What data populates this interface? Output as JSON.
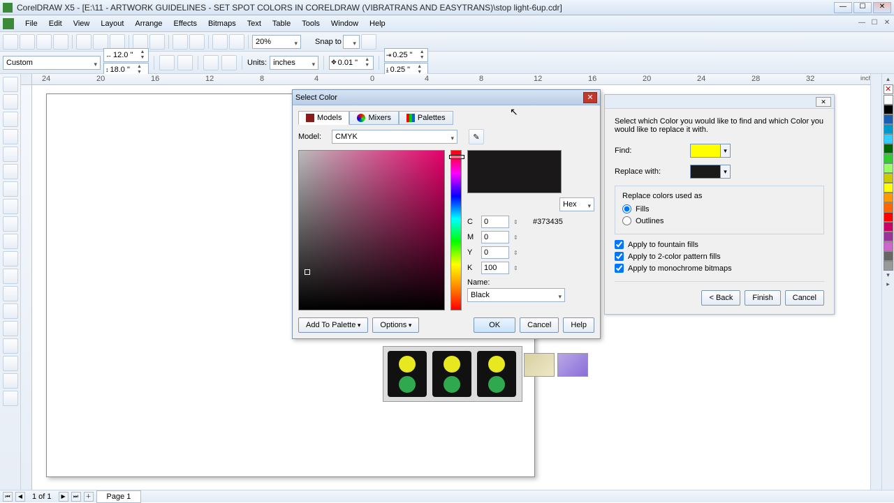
{
  "window": {
    "title": "CorelDRAW X5 - [E:\\11 - ARTWORK GUIDELINES - SET SPOT COLORS IN CORELDRAW (VIBRATRANS AND EASYTRANS)\\stop light-6up.cdr]",
    "min": "—",
    "max": "☐",
    "close": "✕"
  },
  "menu": {
    "items": [
      "File",
      "Edit",
      "View",
      "Layout",
      "Arrange",
      "Effects",
      "Bitmaps",
      "Text",
      "Table",
      "Tools",
      "Window",
      "Help"
    ]
  },
  "std_toolbar": {
    "zoom": "20%",
    "snap_label": "Snap to"
  },
  "prop_bar": {
    "paper": "Custom",
    "w": "12.0 \"",
    "h": "18.0 \"",
    "units_label": "Units:",
    "units": "inches",
    "nudge": "0.01 \"",
    "dup_x": "0.25 \"",
    "dup_y": "0.25 \""
  },
  "ruler": {
    "ticks": [
      "24",
      "20",
      "16",
      "12",
      "8",
      "4",
      "0",
      "4",
      "8",
      "12",
      "16",
      "20",
      "24",
      "28",
      "32"
    ],
    "units": "inches"
  },
  "select_color": {
    "title": "Select Color",
    "tabs": {
      "models": "Models",
      "mixers": "Mixers",
      "palettes": "Palettes"
    },
    "model_label": "Model:",
    "model": "CMYK",
    "format": "Hex",
    "hex": "#373435",
    "c_label": "C",
    "c": "0",
    "m_label": "M",
    "m": "0",
    "y_label": "Y",
    "y": "0",
    "k_label": "K",
    "k": "100",
    "name_label": "Name:",
    "name": "Black",
    "add_palette": "Add To Palette",
    "options": "Options",
    "ok": "OK",
    "cancel": "Cancel",
    "help": "Help"
  },
  "find_replace": {
    "intro": "Select which Color you would like to find and which Color you would like to replace it with.",
    "find_label": "Find:",
    "find_color": "#ffff00",
    "replace_label": "Replace with:",
    "replace_color": "#1a1a1a",
    "group_label": "Replace colors used as",
    "fills": "Fills",
    "outlines": "Outlines",
    "chk_fountain": "Apply to fountain fills",
    "chk_2color": "Apply to 2-color pattern fills",
    "chk_mono": "Apply to monochrome bitmaps",
    "back": "< Back",
    "finish": "Finish",
    "cancel": "Cancel"
  },
  "status": {
    "page_info": "1 of 1",
    "page_tab": "Page 1"
  },
  "palette_colors": [
    "#ffffff",
    "#000000",
    "#1a5fb4",
    "#0099cc",
    "#33ccff",
    "#006600",
    "#33cc33",
    "#99ff66",
    "#cccc00",
    "#ffff00",
    "#ff9900",
    "#ff6600",
    "#ff0000",
    "#cc0066",
    "#993399",
    "#cc66cc",
    "#666666",
    "#999999"
  ]
}
